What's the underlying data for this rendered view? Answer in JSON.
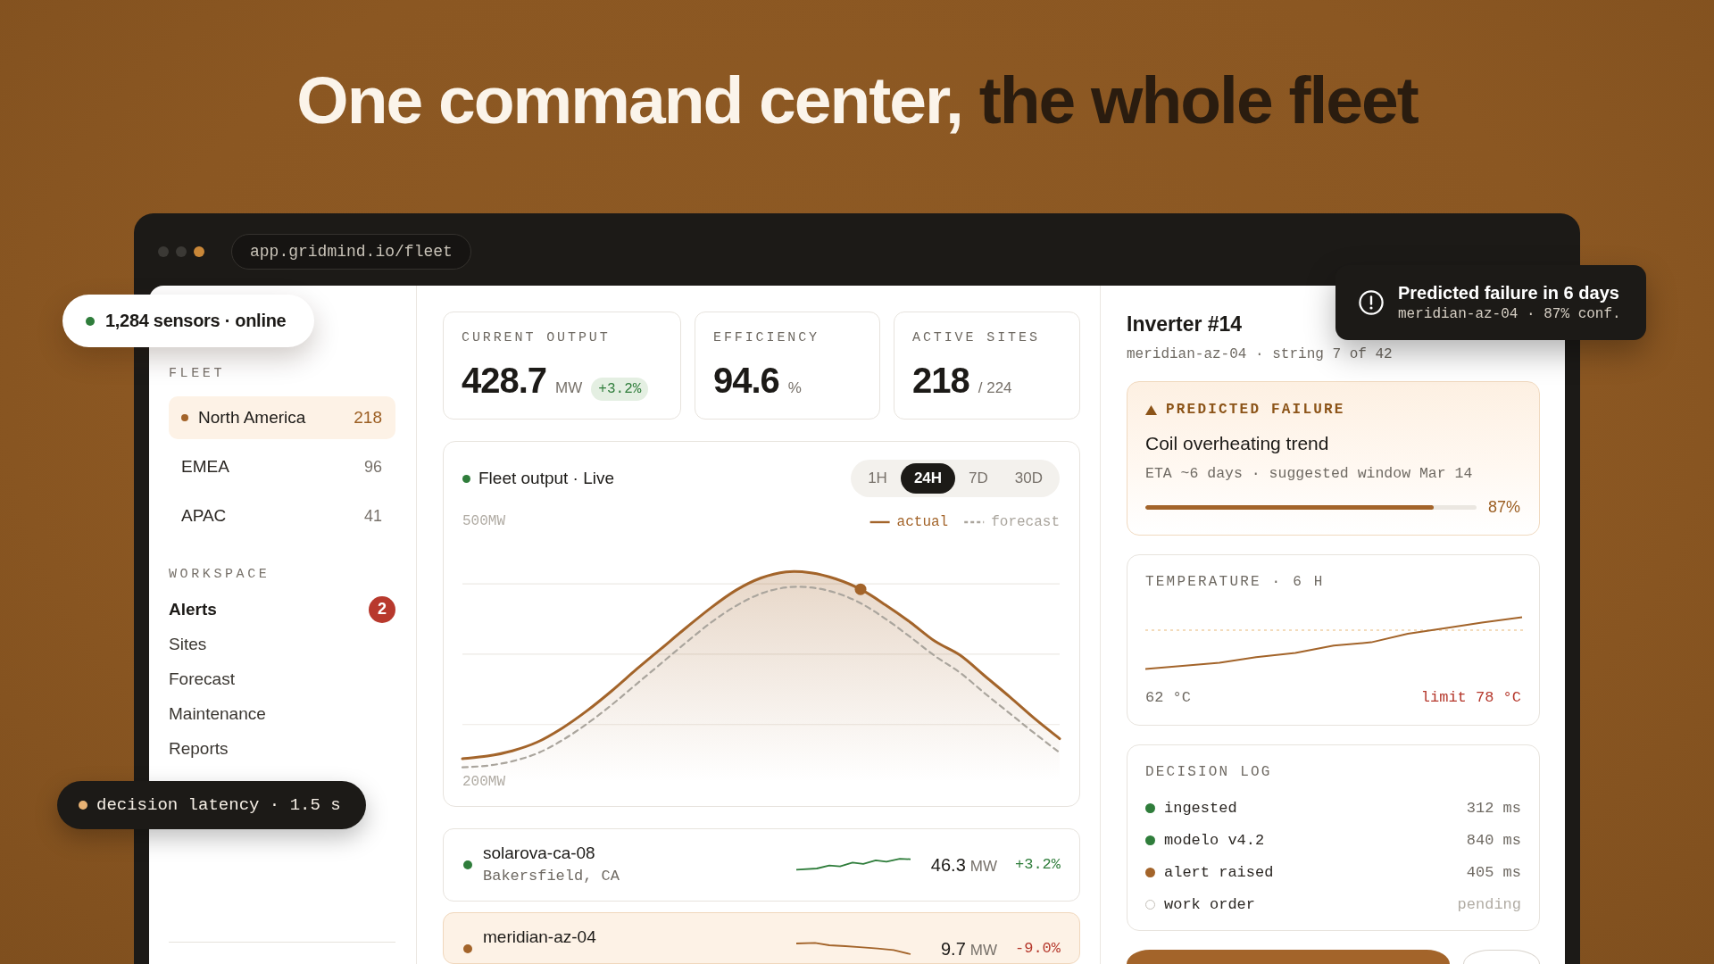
{
  "headline": {
    "lead": "One command center,",
    "rest": "the whole fleet"
  },
  "browser": {
    "url": "app.gridmind.io/fleet"
  },
  "sensor_badge": {
    "text": "1,284 sensors · online"
  },
  "latency_badge": {
    "text": "decision latency · 1.5 s"
  },
  "toast": {
    "title": "Predicted failure in 6 days",
    "detail": "meridian-az-04 · 87% conf."
  },
  "sidebar": {
    "fleet": {
      "heading": "FLEET",
      "items": [
        {
          "label": "North America",
          "count": "218",
          "selected": true
        },
        {
          "label": "EMEA",
          "count": "96",
          "selected": false
        },
        {
          "label": "APAC",
          "count": "41",
          "selected": false
        }
      ]
    },
    "workspace": {
      "heading": "WORKSPACE",
      "items": [
        {
          "label": "Alerts",
          "selected": true,
          "badge": "2"
        },
        {
          "label": "Sites",
          "selected": false
        },
        {
          "label": "Forecast",
          "selected": false
        },
        {
          "label": "Maintenance",
          "selected": false
        },
        {
          "label": "Reports",
          "selected": false
        }
      ]
    }
  },
  "metrics": [
    {
      "label": "CURRENT OUTPUT",
      "value": "428.7",
      "unit": "MW",
      "change": "+3.2%"
    },
    {
      "label": "EFFICIENCY",
      "value": "94.6",
      "unit": "%"
    },
    {
      "label": "ACTIVE SITES",
      "value": "218",
      "unit": "/ 224"
    }
  ],
  "chart": {
    "title": "Fleet output · Live",
    "ranges": [
      {
        "label": "1H",
        "selected": false
      },
      {
        "label": "24H",
        "selected": true
      },
      {
        "label": "7D",
        "selected": false
      },
      {
        "label": "30D",
        "selected": false
      }
    ],
    "chart_data": {
      "type": "area",
      "ylim": [
        171.5,
        592.7
      ],
      "yticks": [
        {
          "value": 500,
          "label": "500MW"
        },
        {
          "value": 200,
          "label": "200MW"
        }
      ],
      "legend": "upper right",
      "series": [
        {
          "name": "actual",
          "color": "#a3642a",
          "line_style": "solid",
          "values": [
            227,
            230,
            236,
            246,
            262,
            282,
            305,
            330,
            354,
            378,
            401,
            421,
            435,
            442,
            441,
            434,
            422,
            404,
            384,
            362,
            346,
            322,
            298,
            273,
            250
          ]
        },
        {
          "name": "forecast",
          "color": "#aaa59d",
          "line_style": "dashed",
          "type": "line",
          "values": [
            217,
            219,
            224,
            233,
            248,
            267,
            289,
            313,
            337,
            361,
            384,
            403,
            417,
            424,
            424,
            418,
            406,
            388,
            367,
            345,
            326,
            302,
            279,
            256,
            234
          ]
        }
      ]
    }
  },
  "sites": [
    {
      "name": "solarova-ca-08",
      "location": "Bakersfield, CA",
      "value": "46.3",
      "unit": "MW",
      "change": "+3.2%",
      "kind": "up",
      "color": "#2f7d3b",
      "selected": false
    },
    {
      "name": "meridian-az-04",
      "value": "9.7",
      "unit": "MW",
      "change": "-9.0%",
      "kind": "down",
      "color": "#a3642a",
      "selected": true
    }
  ],
  "inspector": {
    "title": "Inverter #14",
    "subtitle": "meridian-az-04 · string 7 of 42",
    "prediction": {
      "label": "PREDICTED FAILURE",
      "title": "Coil overheating trend",
      "detail": "ETA ~6 days · suggested window Mar 14",
      "level": 0.87,
      "reading": "87%"
    },
    "temperature": {
      "label": "TEMPERATURE · 6 H",
      "current": "62 °C",
      "limit": "limit 78 °C"
    },
    "decision_log": {
      "label": "DECISION LOG",
      "entries": [
        {
          "step": "ingested",
          "time": "312 ms",
          "kind": "done"
        },
        {
          "step": "modelo v4.2",
          "time": "840 ms",
          "kind": "done"
        },
        {
          "step": "alert raised",
          "time": "405 ms",
          "kind": "alert"
        },
        {
          "step": "work order",
          "time": "pending",
          "kind": "pending"
        }
      ]
    }
  }
}
